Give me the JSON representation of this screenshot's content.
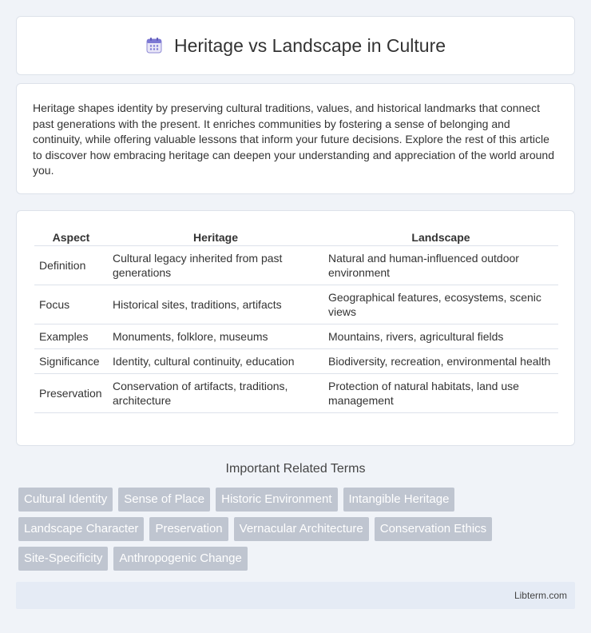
{
  "header": {
    "title": "Heritage vs Landscape in Culture",
    "icon": "calendar-icon"
  },
  "intro": {
    "text": "Heritage shapes identity by preserving cultural traditions, values, and historical landmarks that connect past generations with the present. It enriches communities by fostering a sense of belonging and continuity, while offering valuable lessons that inform your future decisions. Explore the rest of this article to discover how embracing heritage can deepen your understanding and appreciation of the world around you."
  },
  "table": {
    "headers": [
      "Aspect",
      "Heritage",
      "Landscape"
    ],
    "rows": [
      [
        "Definition",
        "Cultural legacy inherited from past generations",
        "Natural and human-influenced outdoor environment"
      ],
      [
        "Focus",
        "Historical sites, traditions, artifacts",
        "Geographical features, ecosystems, scenic views"
      ],
      [
        "Examples",
        "Monuments, folklore, museums",
        "Mountains, rivers, agricultural fields"
      ],
      [
        "Significance",
        "Identity, cultural continuity, education",
        "Biodiversity, recreation, environmental health"
      ],
      [
        "Preservation",
        "Conservation of artifacts, traditions, architecture",
        "Protection of natural habitats, land use management"
      ]
    ]
  },
  "related": {
    "title": "Important Related Terms",
    "tags": [
      "Cultural Identity",
      "Sense of Place",
      "Historic Environment",
      "Intangible Heritage",
      "Landscape Character",
      "Preservation",
      "Vernacular Architecture",
      "Conservation Ethics",
      "Site-Specificity",
      "Anthropogenic Change"
    ]
  },
  "footer": {
    "site": "Libterm.com"
  },
  "colors": {
    "background": "#f0f3f8",
    "tag": "#bfc5d0",
    "footer": "#e5ebf5"
  }
}
